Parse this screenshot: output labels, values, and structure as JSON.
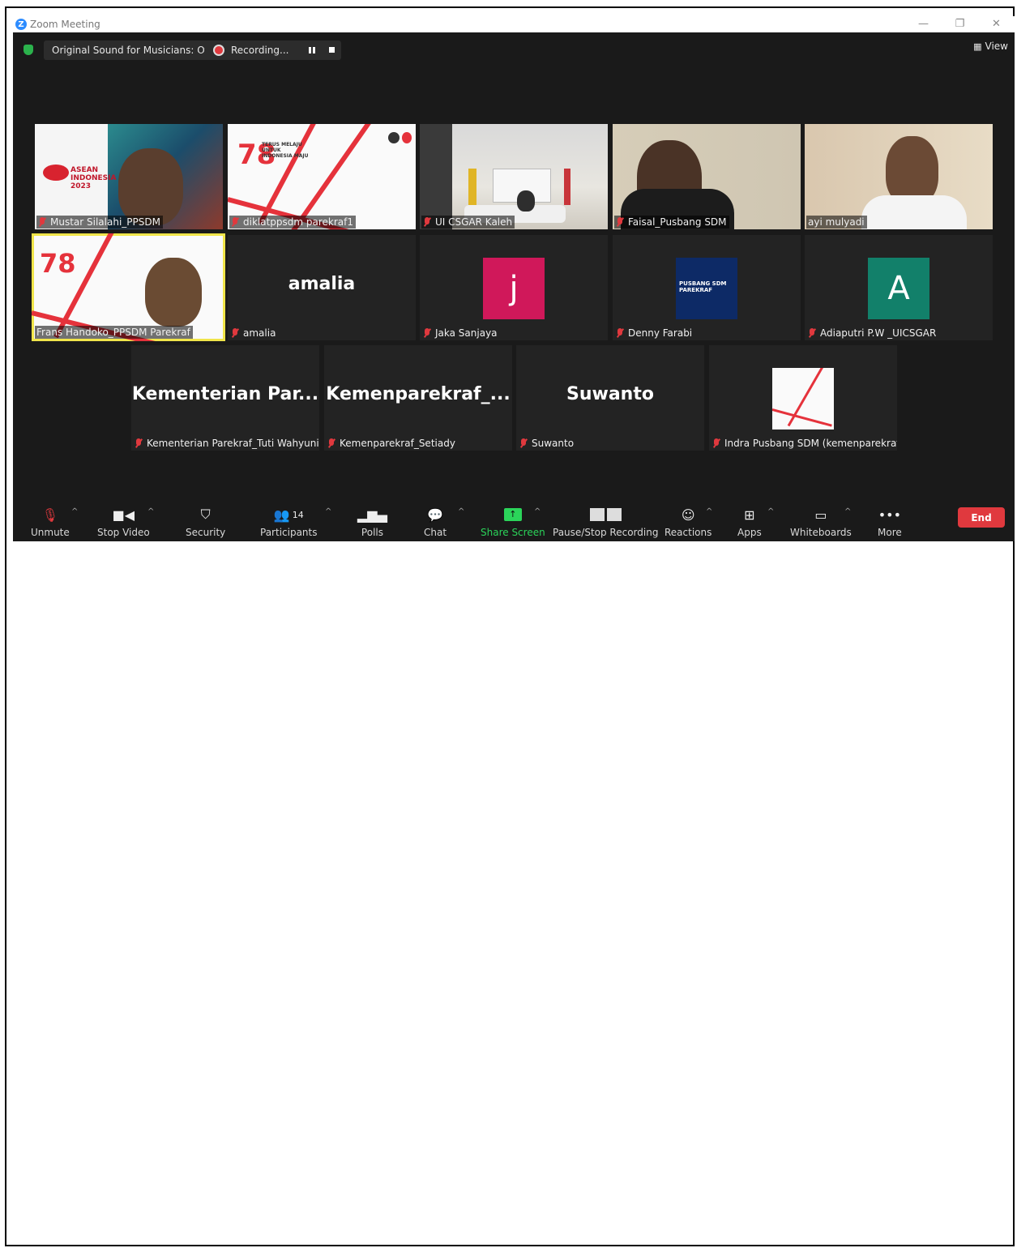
{
  "window": {
    "title": "Zoom Meeting",
    "controls": [
      "—",
      "❐",
      "✕"
    ]
  },
  "topbar": {
    "sound_label": "Original Sound for Musicians: Off",
    "recording_label": "Recording...",
    "view_label": "View"
  },
  "tiles_row1": [
    {
      "name": "Mustar Silalahi_PPSDM",
      "overlay": "ASEAN INDONESIA 2023"
    },
    {
      "name": "diklatppsdm parekraf1",
      "overlay": "TERUS MELAJU UNTUK INDONESIA MAJU"
    },
    {
      "name": "UI CSGAR Kaleh"
    },
    {
      "name": "Faisal_Pusbang SDM"
    },
    {
      "name": "ayi mulyadi"
    }
  ],
  "tiles_row2": [
    {
      "name": "Frans Handoko_PPSDM Parekraf"
    },
    {
      "name": "amalia",
      "display": "amalia"
    },
    {
      "name": "Jaka Sanjaya",
      "avatar_letter": "j",
      "avatar_color": "#d0185a"
    },
    {
      "name": "Denny Farabi",
      "overlay": "PUSBANG SDM PAREKRAF"
    },
    {
      "name": "Adiaputri P.W _UICSGAR",
      "avatar_letter": "A",
      "avatar_color": "#12806a"
    }
  ],
  "tiles_row3": [
    {
      "name": "Kementerian Parekraf_Tuti Wahyuni",
      "display": "Kementerian  Par..."
    },
    {
      "name": "Kemenparekraf_Setiady",
      "display": "Kemenparekraf_..."
    },
    {
      "name": "Suwanto",
      "display": "Suwanto"
    },
    {
      "name": "Indra Pusbang SDM (kemenparekraf)"
    }
  ],
  "toolbar": {
    "unmute": "Unmute",
    "stop_video": "Stop Video",
    "security": "Security",
    "participants": "Participants",
    "participants_count": "14",
    "polls": "Polls",
    "chat": "Chat",
    "share_screen": "Share Screen",
    "pause_stop_recording": "Pause/Stop Recording",
    "reactions": "Reactions",
    "apps": "Apps",
    "whiteboards": "Whiteboards",
    "more": "More",
    "end": "End"
  },
  "colors": {
    "accent_green": "#2bd45a",
    "end_red": "#e0393e",
    "highlight": "#f0e54a"
  }
}
